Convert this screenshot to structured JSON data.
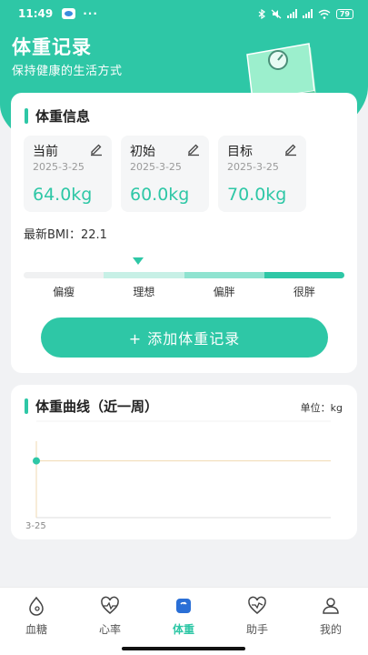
{
  "status_bar": {
    "time": "11:49",
    "dots": "···",
    "battery": "79"
  },
  "header": {
    "title": "体重记录",
    "subtitle": "保持健康的生活方式"
  },
  "weight_info": {
    "title": "体重信息",
    "stats": [
      {
        "label": "当前",
        "date": "2025-3-25",
        "value": "64.0kg"
      },
      {
        "label": "初始",
        "date": "2025-3-25",
        "value": "60.0kg"
      },
      {
        "label": "目标",
        "date": "2025-3-25",
        "value": "70.0kg"
      }
    ],
    "bmi_label": "最新BMI：",
    "bmi_value": "22.1",
    "bmi_scale": [
      {
        "label": "偏瘦",
        "color": "#f0f1f2"
      },
      {
        "label": "理想",
        "color": "#c7f0e6"
      },
      {
        "label": "偏胖",
        "color": "#8fe3d0"
      },
      {
        "label": "很胖",
        "color": "#2ec7a6"
      }
    ],
    "add_button": "+ 添加体重记录"
  },
  "weight_chart": {
    "title": "体重曲线（近一周）",
    "unit": "单位：kg"
  },
  "chart_data": {
    "type": "line",
    "title": "体重曲线（近一周）",
    "ylabel": "kg",
    "categories": [
      "3-25"
    ],
    "series": [
      {
        "values": [
          64.0
        ]
      }
    ],
    "reference_line": 64.0
  },
  "tabs": [
    {
      "label": "血糖",
      "icon": "blood-drop-icon",
      "active": false
    },
    {
      "label": "心率",
      "icon": "heart-pulse-icon",
      "active": false
    },
    {
      "label": "体重",
      "icon": "scale-icon",
      "active": true
    },
    {
      "label": "助手",
      "icon": "heart-assistant-icon",
      "active": false
    },
    {
      "label": "我的",
      "icon": "user-icon",
      "active": false
    }
  ],
  "colors": {
    "accent": "#2ec7a6",
    "axis": "#f1d9b0"
  }
}
